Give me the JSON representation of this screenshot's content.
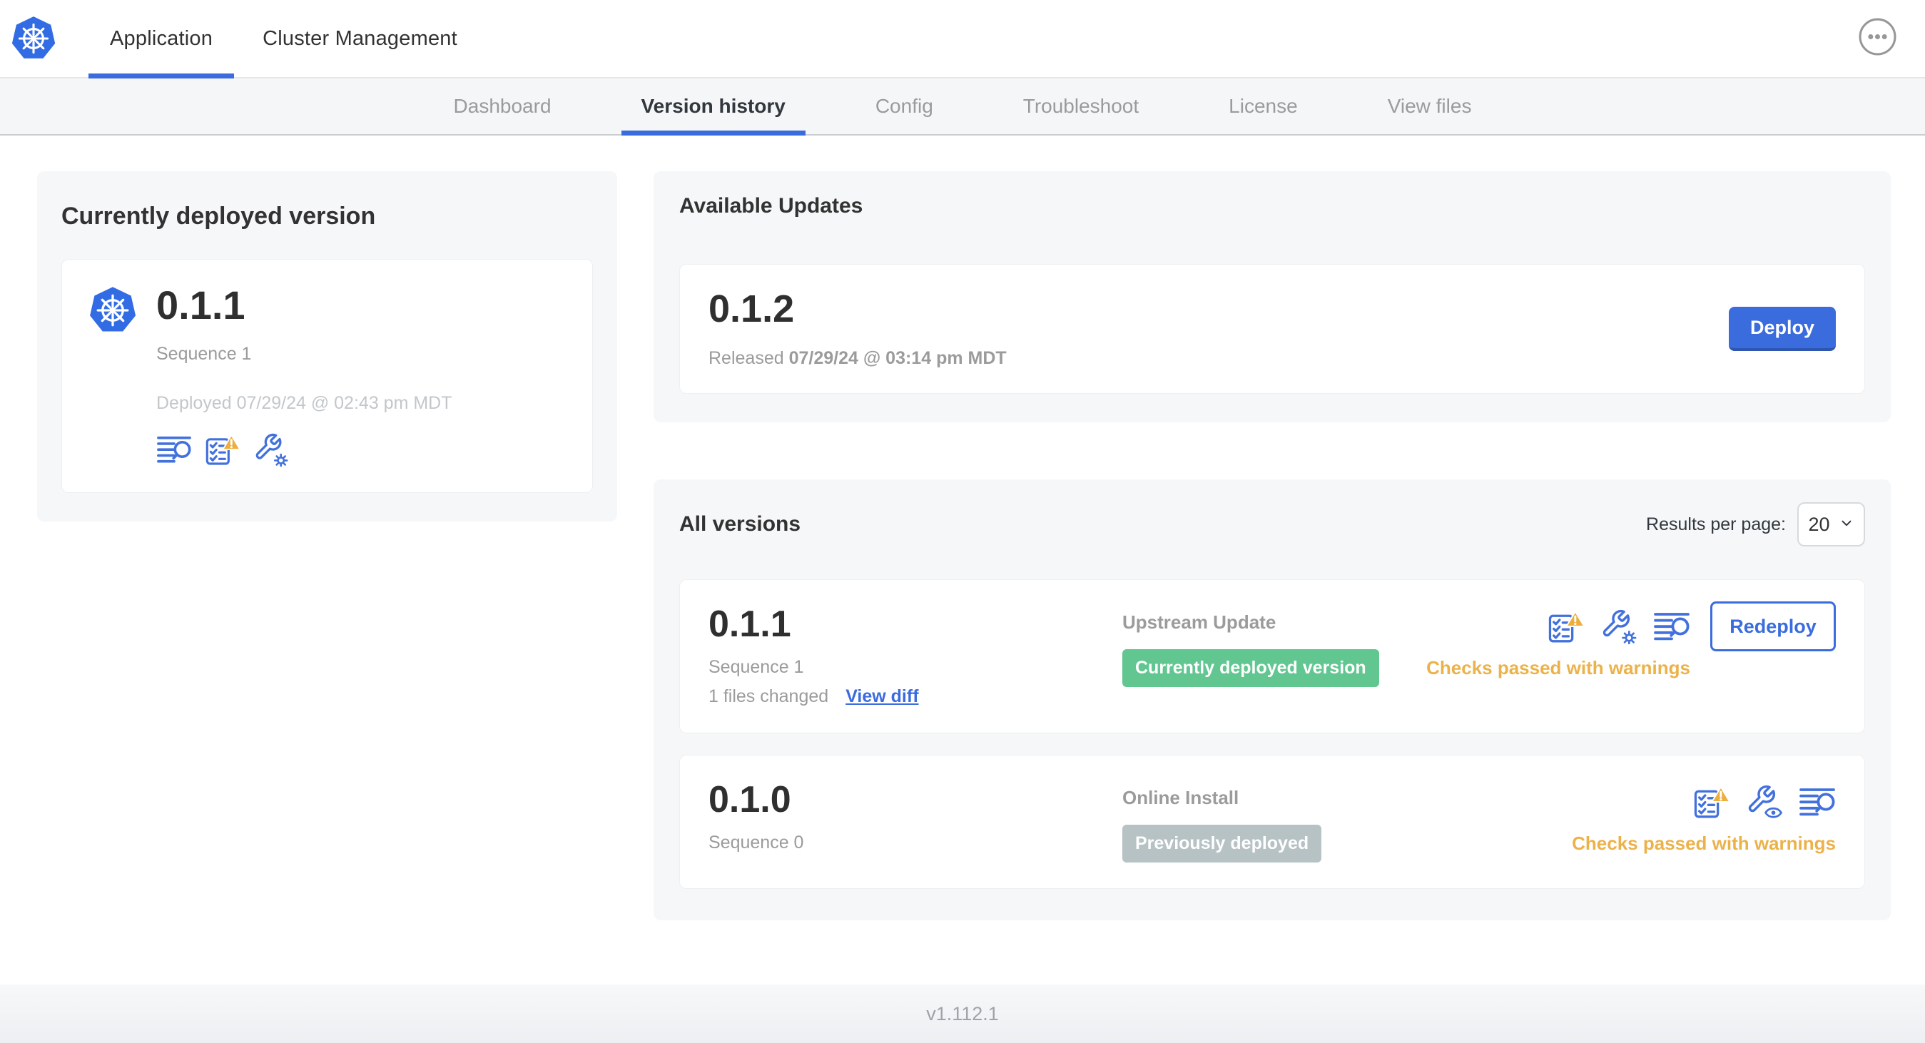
{
  "colors": {
    "accent_blue": "#3B6CDE",
    "kubernetes_blue": "#326CE5",
    "warning_amber": "#ECB24A",
    "badge_green": "#61C690",
    "badge_gray": "#B7C2C5",
    "panel_gray": "#F5F7F8"
  },
  "header": {
    "tabs": [
      {
        "label": "Application"
      },
      {
        "label": "Cluster Management"
      }
    ],
    "active_tab": "Application",
    "overflow_menu_icon": "ellipsis-icon",
    "logo_icon": "kubernetes-logo"
  },
  "subnav": {
    "tabs": [
      {
        "label": "Dashboard"
      },
      {
        "label": "Version history"
      },
      {
        "label": "Config"
      },
      {
        "label": "Troubleshoot"
      },
      {
        "label": "License"
      },
      {
        "label": "View files"
      }
    ],
    "active_tab": "Version history"
  },
  "current_version": {
    "title": "Currently deployed version",
    "version": "0.1.1",
    "sequence": "Sequence 1",
    "deployed": "Deployed 07/29/24 @ 02:43 pm MDT",
    "icons": [
      "logs-icon",
      "preflight-checks-warning-icon",
      "edit-config-icon"
    ]
  },
  "available_updates": {
    "title": "Available Updates",
    "version": "0.1.2",
    "released_label": "Released",
    "released_date": "07/29/24 @ 03:14 pm MDT",
    "deploy_button": "Deploy"
  },
  "all_versions": {
    "title": "All versions",
    "results_per_page_label": "Results per page:",
    "results_per_page_value": "20",
    "rows": [
      {
        "version": "0.1.1",
        "sequence": "Sequence 1",
        "files_changed": "1 files changed",
        "view_diff_link": "View diff",
        "source": "Upstream Update",
        "status_badge": "Currently deployed version",
        "status_type": "green",
        "checks_status": "Checks passed with warnings",
        "action_button": "Redeploy",
        "icons": [
          "preflight-checks-warning-icon",
          "edit-config-icon",
          "logs-icon"
        ]
      },
      {
        "version": "0.1.0",
        "sequence": "Sequence 0",
        "source": "Online Install",
        "status_badge": "Previously deployed",
        "status_type": "gray",
        "checks_status": "Checks passed with warnings",
        "icons": [
          "preflight-checks-warning-icon",
          "view-config-icon",
          "logs-icon"
        ]
      }
    ]
  },
  "footer": {
    "app_version": "v1.112.1"
  }
}
